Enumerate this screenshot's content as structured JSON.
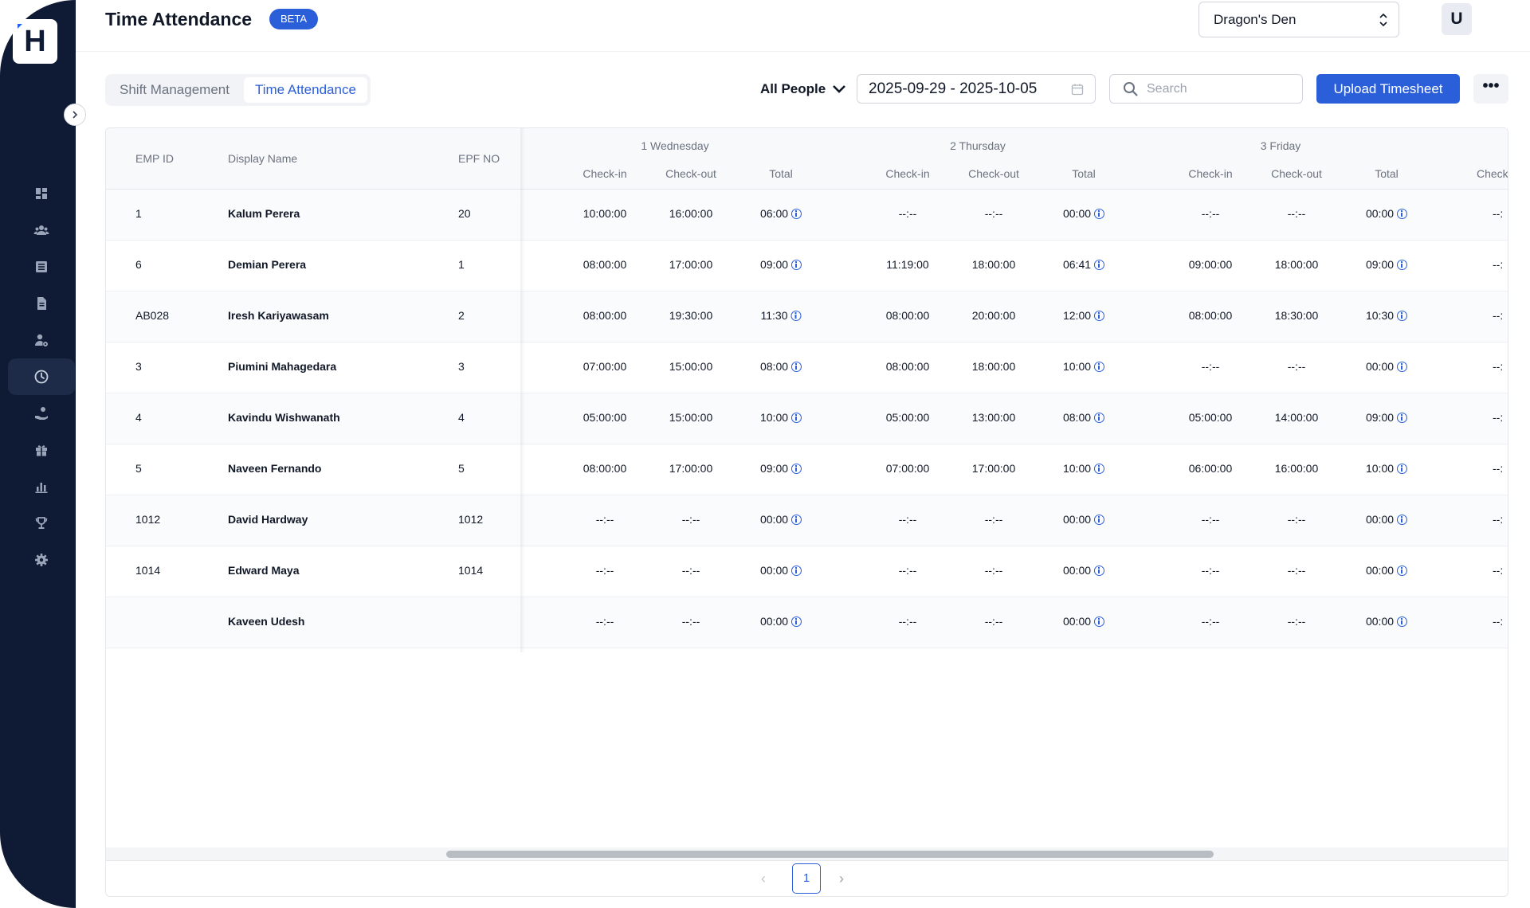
{
  "app": {
    "logo_letter": "H"
  },
  "header": {
    "title": "Time Attendance",
    "badge": "BETA",
    "organization": "Dragon's Den",
    "avatar_letter": "U"
  },
  "sidebar": {
    "items": [
      {
        "icon": "dashboard-icon"
      },
      {
        "icon": "people-icon"
      },
      {
        "icon": "list-icon"
      },
      {
        "icon": "document-icon"
      },
      {
        "icon": "user-gear-icon"
      },
      {
        "icon": "clock-icon",
        "active": true
      },
      {
        "icon": "hand-coin-icon"
      },
      {
        "icon": "gift-icon"
      },
      {
        "icon": "bar-chart-icon"
      },
      {
        "icon": "trophy-icon"
      },
      {
        "icon": "gear-icon"
      }
    ]
  },
  "toolbar": {
    "tabs": [
      {
        "label": "Shift Management",
        "active": false
      },
      {
        "label": "Time Attendance",
        "active": true
      }
    ],
    "people_filter": "All People",
    "date_range": "2025-09-29 - 2025-10-05",
    "search_placeholder": "Search",
    "upload_label": "Upload Timesheet",
    "more_label": "•••"
  },
  "table": {
    "columns": {
      "emp_id": "EMP ID",
      "display_name": "Display Name",
      "epf_no": "EPF NO"
    },
    "sub_columns": {
      "check_in": "Check-in",
      "check_out": "Check-out",
      "total": "Total",
      "check_partial": "Check"
    },
    "days": [
      "1 Wednesday",
      "2 Thursday",
      "3 Friday"
    ],
    "rows": [
      {
        "emp_id": "1",
        "name": "Kalum Perera",
        "epf": "20",
        "days": [
          [
            "10:00:00",
            "16:00:00",
            "06:00"
          ],
          [
            "--:--",
            "--:--",
            "00:00"
          ],
          [
            "--:--",
            "--:--",
            "00:00"
          ]
        ],
        "next": "--:"
      },
      {
        "emp_id": "6",
        "name": "Demian Perera",
        "epf": "1",
        "days": [
          [
            "08:00:00",
            "17:00:00",
            "09:00"
          ],
          [
            "11:19:00",
            "18:00:00",
            "06:41"
          ],
          [
            "09:00:00",
            "18:00:00",
            "09:00"
          ]
        ],
        "next": "--:"
      },
      {
        "emp_id": "AB028",
        "name": "Iresh Kariyawasam",
        "epf": "2",
        "days": [
          [
            "08:00:00",
            "19:30:00",
            "11:30"
          ],
          [
            "08:00:00",
            "20:00:00",
            "12:00"
          ],
          [
            "08:00:00",
            "18:30:00",
            "10:30"
          ]
        ],
        "next": "--:"
      },
      {
        "emp_id": "3",
        "name": "Piumini Mahagedara",
        "epf": "3",
        "days": [
          [
            "07:00:00",
            "15:00:00",
            "08:00"
          ],
          [
            "08:00:00",
            "18:00:00",
            "10:00"
          ],
          [
            "--:--",
            "--:--",
            "00:00"
          ]
        ],
        "next": "--:"
      },
      {
        "emp_id": "4",
        "name": "Kavindu Wishwanath",
        "epf": "4",
        "days": [
          [
            "05:00:00",
            "15:00:00",
            "10:00"
          ],
          [
            "05:00:00",
            "13:00:00",
            "08:00"
          ],
          [
            "05:00:00",
            "14:00:00",
            "09:00"
          ]
        ],
        "next": "--:"
      },
      {
        "emp_id": "5",
        "name": "Naveen Fernando",
        "epf": "5",
        "days": [
          [
            "08:00:00",
            "17:00:00",
            "09:00"
          ],
          [
            "07:00:00",
            "17:00:00",
            "10:00"
          ],
          [
            "06:00:00",
            "16:00:00",
            "10:00"
          ]
        ],
        "next": "--:"
      },
      {
        "emp_id": "1012",
        "name": "David Hardway",
        "epf": "1012",
        "days": [
          [
            "--:--",
            "--:--",
            "00:00"
          ],
          [
            "--:--",
            "--:--",
            "00:00"
          ],
          [
            "--:--",
            "--:--",
            "00:00"
          ]
        ],
        "next": "--:"
      },
      {
        "emp_id": "1014",
        "name": "Edward Maya",
        "epf": "1014",
        "days": [
          [
            "--:--",
            "--:--",
            "00:00"
          ],
          [
            "--:--",
            "--:--",
            "00:00"
          ],
          [
            "--:--",
            "--:--",
            "00:00"
          ]
        ],
        "next": "--:"
      },
      {
        "emp_id": "",
        "name": "Kaveen Udesh",
        "epf": "",
        "days": [
          [
            "--:--",
            "--:--",
            "00:00"
          ],
          [
            "--:--",
            "--:--",
            "00:00"
          ],
          [
            "--:--",
            "--:--",
            "00:00"
          ]
        ],
        "next": "--:"
      }
    ]
  },
  "pagination": {
    "current_page": "1",
    "prev": "‹",
    "next": "›"
  },
  "colors": {
    "sidebar_bg": "#0f1b34",
    "accent": "#2b5fd9"
  }
}
